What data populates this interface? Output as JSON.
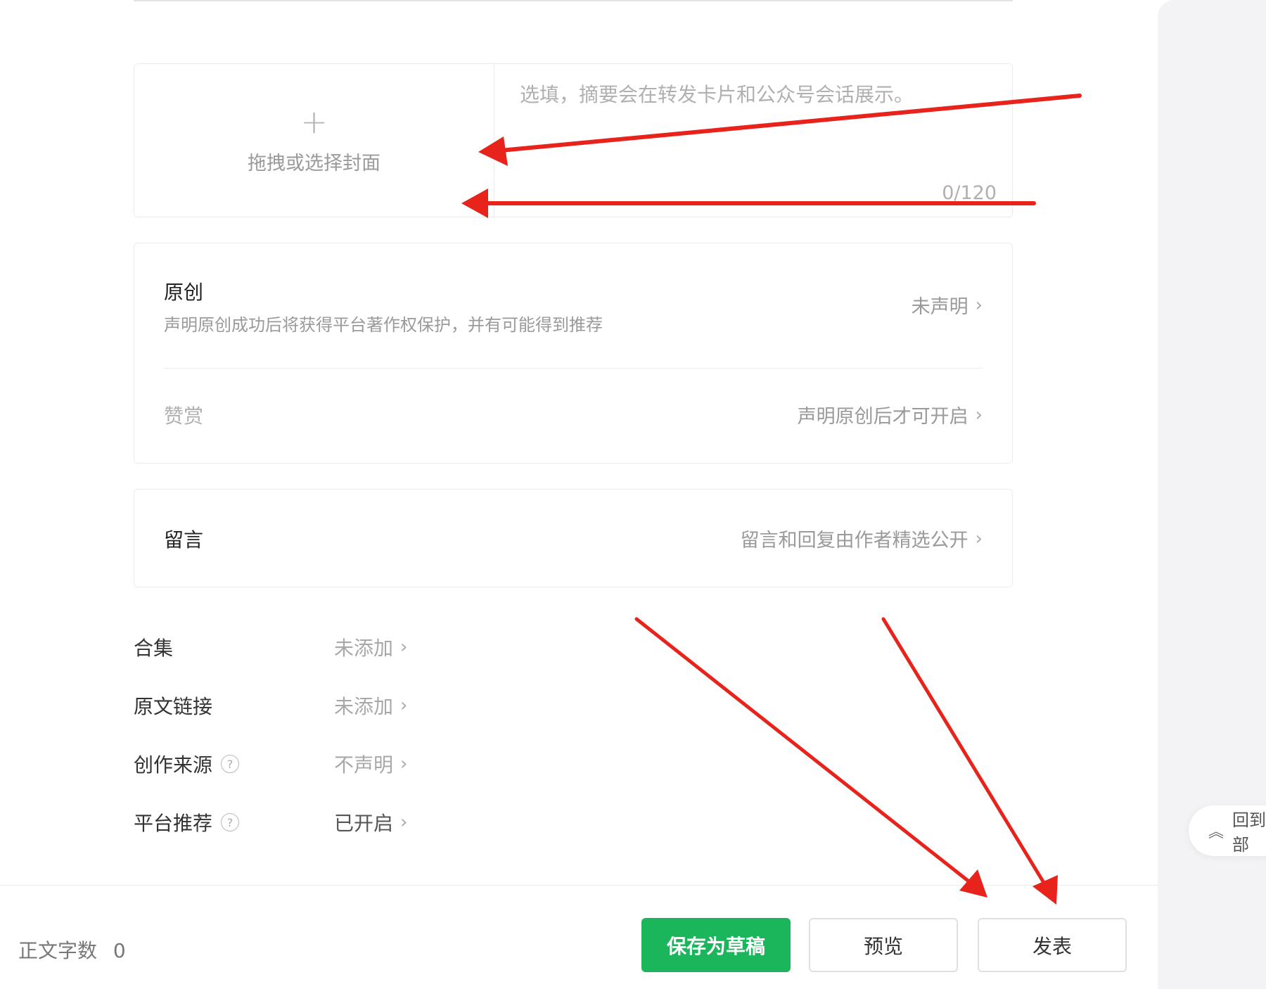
{
  "cover": {
    "plus": "+",
    "label": "拖拽或选择封面"
  },
  "summary": {
    "placeholder": "选填，摘要会在转发卡片和公众号会话展示。",
    "count": "0/120"
  },
  "original": {
    "title": "原创",
    "subtitle": "声明原创成功后将获得平台著作权保护，并有可能得到推荐",
    "status": "未声明",
    "reward_title": "赞赏",
    "reward_status": "声明原创后才可开启"
  },
  "comment": {
    "title": "留言",
    "status": "留言和回复由作者精选公开"
  },
  "settings": [
    {
      "label": "合集",
      "value": "未添加",
      "help": false
    },
    {
      "label": "原文链接",
      "value": "未添加",
      "help": false
    },
    {
      "label": "创作来源",
      "value": "不声明",
      "help": true
    },
    {
      "label": "平台推荐",
      "value": "已开启",
      "help": true
    }
  ],
  "footer": {
    "word_count_label": "正文字数",
    "word_count_value": "0",
    "save_draft": "保存为草稿",
    "preview": "预览",
    "publish": "发表"
  },
  "side": {
    "back_top": "回到顶部"
  },
  "icons": {
    "chevron": "chevron-right-icon",
    "help": "question-circle-icon",
    "back_top": "double-chevron-up-icon"
  },
  "colors": {
    "primary": "#1bb55c",
    "annotation": "#e8231c"
  }
}
